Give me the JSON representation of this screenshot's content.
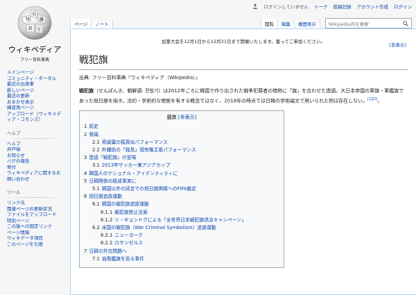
{
  "personal": {
    "not_logged_in": "ログインしていません",
    "talk": "トーク",
    "contributions": "投稿記録",
    "create_account": "アカウント作成",
    "login": "ログイン"
  },
  "logo": {
    "wordmark": "ウィキペディア",
    "tagline": "フリー百科事典"
  },
  "sidebar": {
    "nav": [
      "メインページ",
      "コミュニティ・ポータル",
      "最近の出来事",
      "新しいページ",
      "最近の更新",
      "おまかせ表示",
      "練習用ページ",
      "アップロード（ウィキメディア・コモンズ）"
    ],
    "help_title": "ヘルプ",
    "help": [
      "ヘルプ",
      "井戸端",
      "お知らせ",
      "バグの報告",
      "寄付",
      "ウィキペディアに関するお問い合わせ"
    ],
    "tools_title": "ツール",
    "tools": [
      "リンク元",
      "関連ページの更新状況",
      "ファイルをアップロード",
      "特別ページ",
      "この版への固定リンク",
      "ページ情報",
      "ウィキデータ項目",
      "このページを引用"
    ]
  },
  "tabs": {
    "page": "ページ",
    "note": "ノート",
    "read": "閲覧",
    "edit": "編集",
    "history": "履歴表示"
  },
  "search": {
    "placeholder": "Wikipedia内を検索"
  },
  "content": {
    "sitenotice": "加筆大会を12月1日から12月31日まで開催いたします。奮ってご参加ください。",
    "notice_hide": "[非表示]",
    "title": "戦犯旗",
    "tagline": "出典: フリー百科事典『ウィキペディア（Wikipedia）』",
    "lead_bold": "戦犯旗",
    "lead_text": "（せんぱんき、朝鮮語: 전범기）は2012年ごろに韓国で作り出された戦争犯罪者の暗称に「旗」を合わせた造語。大日本帝国の軍旗・軍艦旗であった旭日旗を指す。法的・学術的な根拠を有する概念ではなく、2018年の時点では日韓の学術論文で用いられた例は存在しない。",
    "lead_refs": "[1][2]",
    "lead_end": "。"
  },
  "toc": {
    "title": "目次",
    "toggle": "[非表示]",
    "items": [
      {
        "num": "1",
        "text": "前史",
        "level": 1
      },
      {
        "num": "2",
        "text": "発端",
        "level": 1
      },
      {
        "num": "2.1",
        "text": "奇誠庸の猿真似パフォーマンス",
        "level": 2
      },
      {
        "num": "2.2",
        "text": "朴鍾佑の「独島」領有権主張パフォーマンス",
        "level": 2
      },
      {
        "num": "3",
        "text": "造語『戦犯旗』の登場",
        "level": 1
      },
      {
        "num": "3.1",
        "text": "2013年サッカー東アジアカップ",
        "level": 2
      },
      {
        "num": "4",
        "text": "韓国人のナショナル・アイデンティティに",
        "level": 1
      },
      {
        "num": "5",
        "text": "日韓関係の既成事実に",
        "level": 1
      },
      {
        "num": "5.1",
        "text": "韓国以外の試合での旭日旗掲揚へのFIFA裁定",
        "level": 2
      },
      {
        "num": "6",
        "text": "旭日旗追放運動",
        "level": 1
      },
      {
        "num": "6.1",
        "text": "韓国の戦犯旗追放運動",
        "level": 2
      },
      {
        "num": "6.1.1",
        "text": "戦犯旗禁止法案",
        "level": 3
      },
      {
        "num": "6.1.2",
        "text": "ソ・ギョンドクによる「全世界日本戦犯旗退治キャンペーン」",
        "level": 3
      },
      {
        "num": "6.2",
        "text": "米国の戦犯旗（War Criminal Symbolism）追放運動",
        "level": 2
      },
      {
        "num": "6.2.1",
        "text": "ニューヨーク",
        "level": 3
      },
      {
        "num": "6.2.2",
        "text": "ロサンゼルス",
        "level": 3
      },
      {
        "num": "7",
        "text": "日韓の外交問題へ",
        "level": 1
      },
      {
        "num": "7.1",
        "text": "自衛艦旗を巡る事件",
        "level": 2
      }
    ]
  }
}
